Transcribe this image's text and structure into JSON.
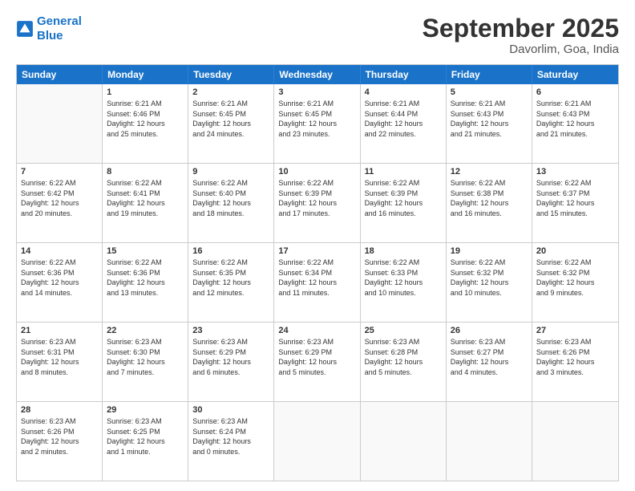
{
  "header": {
    "logo_line1": "General",
    "logo_line2": "Blue",
    "month": "September 2025",
    "location": "Davorlim, Goa, India"
  },
  "weekdays": [
    "Sunday",
    "Monday",
    "Tuesday",
    "Wednesday",
    "Thursday",
    "Friday",
    "Saturday"
  ],
  "weeks": [
    [
      {
        "day": "",
        "empty": true
      },
      {
        "day": "1",
        "sunrise": "6:21 AM",
        "sunset": "6:46 PM",
        "daylight": "12 hours and 25 minutes."
      },
      {
        "day": "2",
        "sunrise": "6:21 AM",
        "sunset": "6:45 PM",
        "daylight": "12 hours and 24 minutes."
      },
      {
        "day": "3",
        "sunrise": "6:21 AM",
        "sunset": "6:45 PM",
        "daylight": "12 hours and 23 minutes."
      },
      {
        "day": "4",
        "sunrise": "6:21 AM",
        "sunset": "6:44 PM",
        "daylight": "12 hours and 22 minutes."
      },
      {
        "day": "5",
        "sunrise": "6:21 AM",
        "sunset": "6:43 PM",
        "daylight": "12 hours and 21 minutes."
      },
      {
        "day": "6",
        "sunrise": "6:21 AM",
        "sunset": "6:43 PM",
        "daylight": "12 hours and 21 minutes."
      }
    ],
    [
      {
        "day": "7",
        "sunrise": "6:22 AM",
        "sunset": "6:42 PM",
        "daylight": "12 hours and 20 minutes."
      },
      {
        "day": "8",
        "sunrise": "6:22 AM",
        "sunset": "6:41 PM",
        "daylight": "12 hours and 19 minutes."
      },
      {
        "day": "9",
        "sunrise": "6:22 AM",
        "sunset": "6:40 PM",
        "daylight": "12 hours and 18 minutes."
      },
      {
        "day": "10",
        "sunrise": "6:22 AM",
        "sunset": "6:39 PM",
        "daylight": "12 hours and 17 minutes."
      },
      {
        "day": "11",
        "sunrise": "6:22 AM",
        "sunset": "6:39 PM",
        "daylight": "12 hours and 16 minutes."
      },
      {
        "day": "12",
        "sunrise": "6:22 AM",
        "sunset": "6:38 PM",
        "daylight": "12 hours and 16 minutes."
      },
      {
        "day": "13",
        "sunrise": "6:22 AM",
        "sunset": "6:37 PM",
        "daylight": "12 hours and 15 minutes."
      }
    ],
    [
      {
        "day": "14",
        "sunrise": "6:22 AM",
        "sunset": "6:36 PM",
        "daylight": "12 hours and 14 minutes."
      },
      {
        "day": "15",
        "sunrise": "6:22 AM",
        "sunset": "6:36 PM",
        "daylight": "12 hours and 13 minutes."
      },
      {
        "day": "16",
        "sunrise": "6:22 AM",
        "sunset": "6:35 PM",
        "daylight": "12 hours and 12 minutes."
      },
      {
        "day": "17",
        "sunrise": "6:22 AM",
        "sunset": "6:34 PM",
        "daylight": "12 hours and 11 minutes."
      },
      {
        "day": "18",
        "sunrise": "6:22 AM",
        "sunset": "6:33 PM",
        "daylight": "12 hours and 10 minutes."
      },
      {
        "day": "19",
        "sunrise": "6:22 AM",
        "sunset": "6:32 PM",
        "daylight": "12 hours and 10 minutes."
      },
      {
        "day": "20",
        "sunrise": "6:22 AM",
        "sunset": "6:32 PM",
        "daylight": "12 hours and 9 minutes."
      }
    ],
    [
      {
        "day": "21",
        "sunrise": "6:23 AM",
        "sunset": "6:31 PM",
        "daylight": "12 hours and 8 minutes."
      },
      {
        "day": "22",
        "sunrise": "6:23 AM",
        "sunset": "6:30 PM",
        "daylight": "12 hours and 7 minutes."
      },
      {
        "day": "23",
        "sunrise": "6:23 AM",
        "sunset": "6:29 PM",
        "daylight": "12 hours and 6 minutes."
      },
      {
        "day": "24",
        "sunrise": "6:23 AM",
        "sunset": "6:29 PM",
        "daylight": "12 hours and 5 minutes."
      },
      {
        "day": "25",
        "sunrise": "6:23 AM",
        "sunset": "6:28 PM",
        "daylight": "12 hours and 5 minutes."
      },
      {
        "day": "26",
        "sunrise": "6:23 AM",
        "sunset": "6:27 PM",
        "daylight": "12 hours and 4 minutes."
      },
      {
        "day": "27",
        "sunrise": "6:23 AM",
        "sunset": "6:26 PM",
        "daylight": "12 hours and 3 minutes."
      }
    ],
    [
      {
        "day": "28",
        "sunrise": "6:23 AM",
        "sunset": "6:26 PM",
        "daylight": "12 hours and 2 minutes."
      },
      {
        "day": "29",
        "sunrise": "6:23 AM",
        "sunset": "6:25 PM",
        "daylight": "12 hours and 1 minute."
      },
      {
        "day": "30",
        "sunrise": "6:23 AM",
        "sunset": "6:24 PM",
        "daylight": "12 hours and 0 minutes."
      },
      {
        "day": "",
        "empty": true
      },
      {
        "day": "",
        "empty": true
      },
      {
        "day": "",
        "empty": true
      },
      {
        "day": "",
        "empty": true
      }
    ]
  ]
}
